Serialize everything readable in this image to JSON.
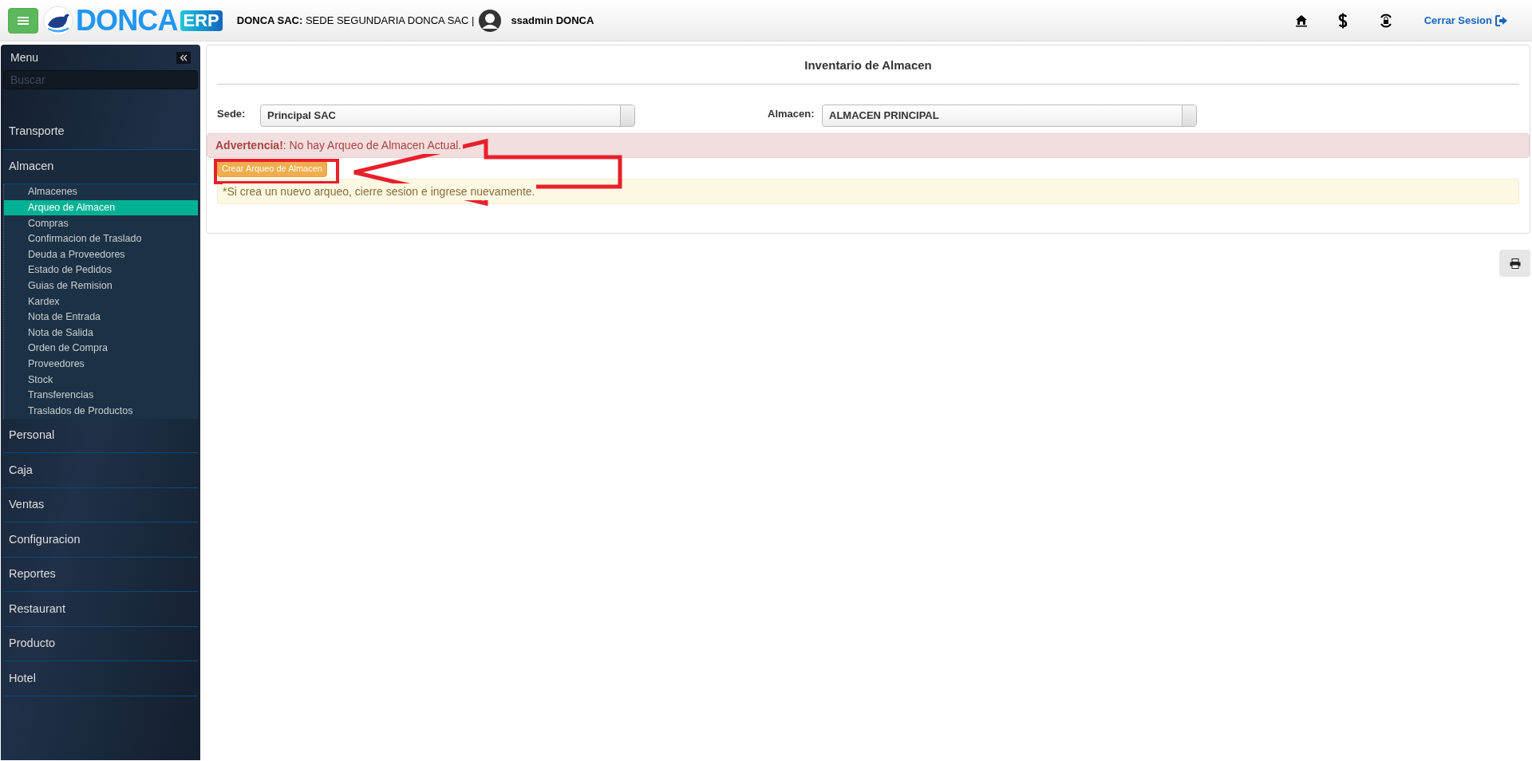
{
  "header": {
    "brand": "DONCA",
    "brand_badge": "ERP",
    "company_label": "DONCA SAC:",
    "company_branch": "SEDE SEGUNDARIA DONCA SAC |",
    "user": "ssadmin DONCA",
    "logout": "Cerrar Sesion"
  },
  "sidebar": {
    "title": "Menu",
    "search": {
      "placeholder": "Buscar"
    },
    "items": [
      {
        "label": "Transporte",
        "expanded": false
      },
      {
        "label": "Almacen",
        "expanded": true,
        "children": [
          {
            "label": "Almacenes",
            "selected": false
          },
          {
            "label": "Arqueo de Almacen",
            "selected": true
          },
          {
            "label": "Compras",
            "selected": false
          },
          {
            "label": "Confirmacion de Traslado",
            "selected": false
          },
          {
            "label": "Deuda a Proveedores",
            "selected": false
          },
          {
            "label": "Estado de Pedidos",
            "selected": false
          },
          {
            "label": "Guias de Remision",
            "selected": false
          },
          {
            "label": "Kardex",
            "selected": false
          },
          {
            "label": "Nota de Entrada",
            "selected": false
          },
          {
            "label": "Nota de Salida",
            "selected": false
          },
          {
            "label": "Orden de Compra",
            "selected": false
          },
          {
            "label": "Proveedores",
            "selected": false
          },
          {
            "label": "Stock",
            "selected": false
          },
          {
            "label": "Transferencias",
            "selected": false
          },
          {
            "label": "Traslados de Productos",
            "selected": false
          }
        ]
      },
      {
        "label": "Personal",
        "expanded": false
      },
      {
        "label": "Caja",
        "expanded": false
      },
      {
        "label": "Ventas",
        "expanded": false
      },
      {
        "label": "Configuracion",
        "expanded": false
      },
      {
        "label": "Reportes",
        "expanded": false
      },
      {
        "label": "Restaurant",
        "expanded": false
      },
      {
        "label": "Producto",
        "expanded": false
      },
      {
        "label": "Hotel",
        "expanded": false
      }
    ]
  },
  "panel": {
    "title": "Inventario de Almacen",
    "fields": [
      {
        "label": "Sede:",
        "value": "Principal SAC"
      },
      {
        "label": "Almacen:",
        "value": "ALMACEN PRINCIPAL"
      }
    ],
    "warning": "**Advertencia!**: No hay Arqueo de Almacen Actual.",
    "button": "Crear Arqueo de Almacen",
    "note": "*Si crea un nuevo arqueo, cierre sesion e ingrese nuevamente."
  }
}
